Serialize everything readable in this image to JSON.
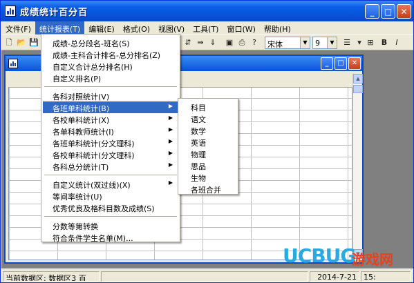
{
  "app": {
    "title": "成绩统计百分百"
  },
  "window_buttons": {
    "minimize": "_",
    "maximize": "□",
    "close": "✕"
  },
  "menubar": [
    {
      "label": "文件(F)",
      "active": false
    },
    {
      "label": "统计报表(T)",
      "active": true
    },
    {
      "label": "编辑(E)",
      "active": false
    },
    {
      "label": "格式(O)",
      "active": false
    },
    {
      "label": "视图(V)",
      "active": false
    },
    {
      "label": "工具(T)",
      "active": false
    },
    {
      "label": "窗口(W)",
      "active": false
    },
    {
      "label": "帮助(H)",
      "active": false
    }
  ],
  "toolbar": {
    "font_name": "宋体",
    "font_size": "9",
    "bold": "B",
    "italic": "I"
  },
  "stats_menu": {
    "group1": [
      "成绩-总分段名-班名(S)",
      "成绩-主科合计排名-总分排名(Z)",
      "自定义合计总分排名(H)",
      "自定义排名(P)"
    ],
    "group2": [
      {
        "label": "各科对照统计(V)",
        "submenu": false,
        "highlight": false
      },
      {
        "label": "各班单科统计(B)",
        "submenu": true,
        "highlight": true
      },
      {
        "label": "各校单科统计(X)",
        "submenu": true,
        "highlight": false
      },
      {
        "label": "各单科教师统计(I)",
        "submenu": true,
        "highlight": false
      },
      {
        "label": "各班单科统计(分文理科)",
        "submenu": true,
        "highlight": false
      },
      {
        "label": "各校单科统计(分文理科)",
        "submenu": true,
        "highlight": false
      },
      {
        "label": "各科总分统计(T)",
        "submenu": true,
        "highlight": false
      }
    ],
    "group3": [
      {
        "label": "自定义统计(双过线)(X)",
        "submenu": true
      },
      {
        "label": "等间率统计(U)",
        "submenu": false
      },
      {
        "label": "优秀优良及格科目数及成绩(S)",
        "submenu": false
      }
    ],
    "group4": [
      "分数等第转换",
      "符合条件学生名单(M)..."
    ]
  },
  "subject_submenu": [
    "科目",
    "语文",
    "数学",
    "英语",
    "物理",
    "思品",
    "生物",
    "各班合并"
  ],
  "statusbar": {
    "current_area_label": "当前数据区:",
    "current_area_value": "数据区3 百",
    "date": "2014-7-21",
    "time": "15:"
  },
  "watermark": {
    "brand": "UCBUG",
    "cn": "游戏网"
  },
  "colors": {
    "titlebar": "#0654d7",
    "menu_highlight": "#316ac5",
    "close_button": "#c73c18"
  }
}
